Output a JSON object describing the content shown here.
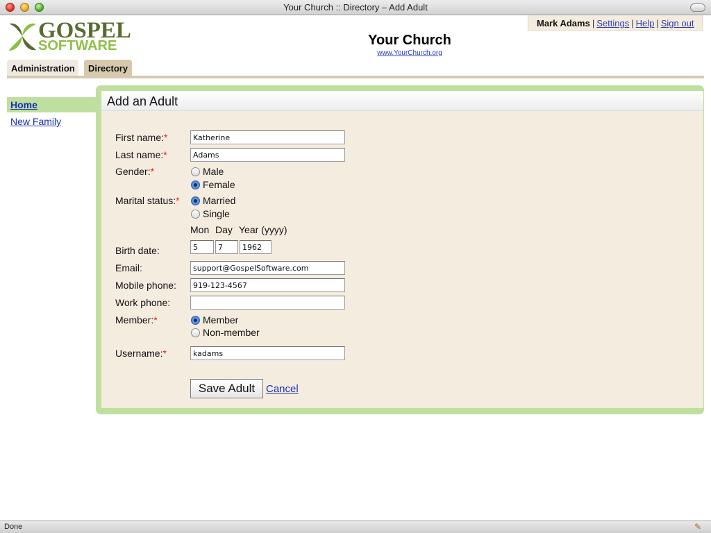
{
  "window": {
    "title": "Your Church :: Directory – Add Adult"
  },
  "logo": {
    "line1": "GOSPEL",
    "line2": "SOFTWARE",
    "colors": {
      "dark": "#5a6b31",
      "light": "#8dbf45"
    }
  },
  "header": {
    "church_name": "Your Church",
    "church_url": "www.YourChurch.org"
  },
  "user_menu": {
    "user_name": "Mark Adams",
    "settings": "Settings",
    "help": "Help",
    "sign_out": "Sign out",
    "separator": "|"
  },
  "tabs": [
    {
      "label": "Administration",
      "active": false
    },
    {
      "label": "Directory",
      "active": true
    }
  ],
  "sidebar": {
    "items": [
      {
        "label": "Home",
        "active": true
      },
      {
        "label": "New Family",
        "active": false
      }
    ]
  },
  "panel": {
    "title": "Add an Adult"
  },
  "form": {
    "required_mark": "*",
    "first_name": {
      "label": "First name:",
      "value": "Katherine"
    },
    "last_name": {
      "label": "Last name:",
      "value": "Adams"
    },
    "gender": {
      "label": "Gender:",
      "options": [
        "Male",
        "Female"
      ],
      "selected": "Female"
    },
    "marital_status": {
      "label": "Marital status:",
      "options": [
        "Married",
        "Single"
      ],
      "selected": "Married"
    },
    "birth_date": {
      "label": "Birth date:",
      "col_headers": [
        "Mon",
        "Day",
        "Year (yyyy)"
      ],
      "month": "5",
      "day": "7",
      "year": "1962"
    },
    "email": {
      "label": "Email:",
      "value": "support@GospelSoftware.com"
    },
    "mobile_phone": {
      "label": "Mobile phone:",
      "value": "919-123-4567"
    },
    "work_phone": {
      "label": "Work phone:",
      "value": ""
    },
    "member": {
      "label": "Member:",
      "options": [
        "Member",
        "Non-member"
      ],
      "selected": "Member"
    },
    "username": {
      "label": "Username:",
      "value": "kadams"
    },
    "save_label": "Save Adult",
    "cancel_label": "Cancel"
  },
  "status_bar": {
    "text": "Done"
  },
  "colors": {
    "accent_green": "#bfdf9f",
    "panel_bg": "#f4ecdf",
    "tab_active": "#d6c9ac",
    "required": "#e0201a",
    "link": "#1a2fb2"
  }
}
